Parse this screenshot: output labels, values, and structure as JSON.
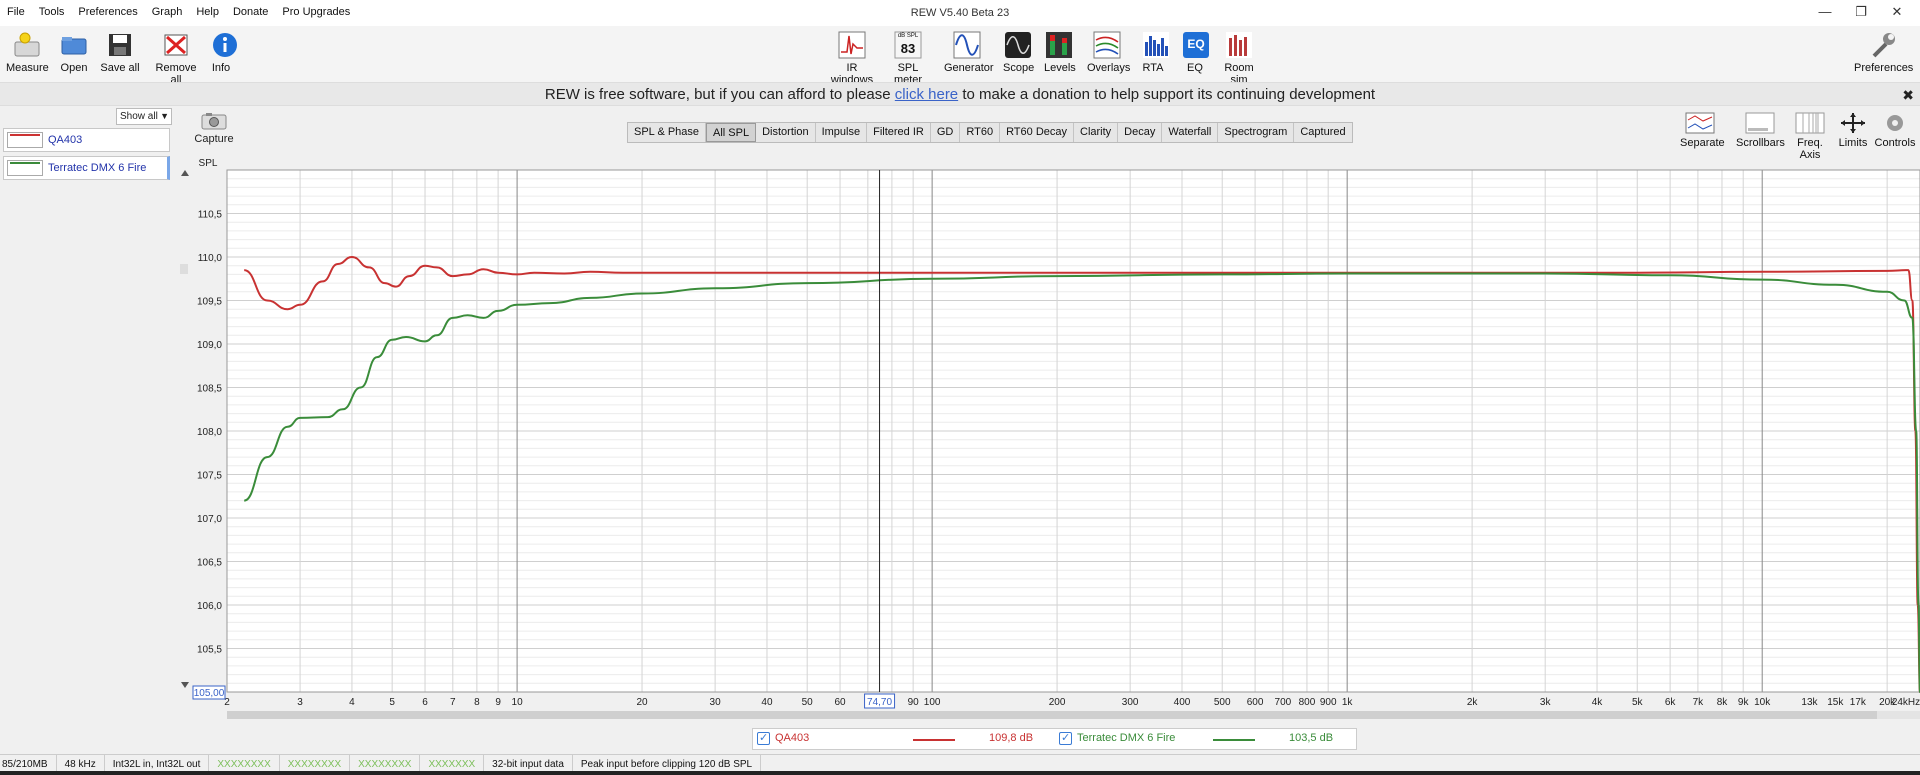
{
  "window": {
    "title": "REW V5.40 Beta 23",
    "menu": [
      "File",
      "Tools",
      "Preferences",
      "Graph",
      "Help",
      "Donate",
      "Pro Upgrades"
    ]
  },
  "toolbar": {
    "left": [
      {
        "label": "Measure",
        "icon": "measure-icon"
      },
      {
        "label": "Open",
        "icon": "open-folder-icon"
      },
      {
        "label": "Save all",
        "icon": "save-disk-icon"
      },
      {
        "label": "Remove all",
        "icon": "remove-all-icon"
      },
      {
        "label": "Info",
        "icon": "info-icon"
      }
    ],
    "center": [
      {
        "label": "IR windows",
        "icon": "ir-windows-icon"
      },
      {
        "label": "SPL meter",
        "icon": "spl-meter-icon"
      },
      {
        "label": "Generator",
        "icon": "generator-icon"
      },
      {
        "label": "Scope",
        "icon": "scope-icon"
      },
      {
        "label": "Levels",
        "icon": "levels-icon"
      },
      {
        "label": "Overlays",
        "icon": "overlays-icon"
      },
      {
        "label": "RTA",
        "icon": "rta-icon"
      },
      {
        "label": "EQ",
        "icon": "eq-icon"
      },
      {
        "label": "Room sim",
        "icon": "room-sim-icon"
      }
    ],
    "spl_meter_caption": "dB SPL",
    "spl_meter_value": "83",
    "eq_text": "EQ",
    "right": {
      "label": "Preferences",
      "icon": "wrench-icon"
    }
  },
  "donate": {
    "before": "REW is free software, but if you can afford to please ",
    "link": "click here",
    "after": " to make a donation to help support its continuing development",
    "close": "✖"
  },
  "sidebar": {
    "filter": "Show all",
    "measurements": [
      {
        "name": "QA403",
        "color": "#cc3333"
      },
      {
        "name": "Terratec DMX 6 Fire",
        "color": "#3a8a3a"
      }
    ]
  },
  "capture_label": "Capture",
  "tabs": [
    "SPL & Phase",
    "All SPL",
    "Distortion",
    "Impulse",
    "Filtered IR",
    "GD",
    "RT60",
    "RT60 Decay",
    "Clarity",
    "Decay",
    "Waterfall",
    "Spectrogram",
    "Captured"
  ],
  "active_tab": "All SPL",
  "graph_controls": [
    {
      "label": "Separate",
      "icon": "separate-icon"
    },
    {
      "label": "Scrollbars",
      "icon": "scrollbars-icon"
    },
    {
      "label": "Freq. Axis",
      "icon": "freq-axis-icon"
    },
    {
      "label": "Limits",
      "icon": "limits-icon"
    },
    {
      "label": "Controls",
      "icon": "controls-gear-icon"
    }
  ],
  "chart_data": {
    "type": "line",
    "ylabel": "SPL",
    "ylim": [
      105.0,
      111.0
    ],
    "yticks": [
      "110,5",
      "110,0",
      "109,5",
      "109,0",
      "108,5",
      "108,0",
      "107,5",
      "107,0",
      "106,5",
      "106,0",
      "105,5"
    ],
    "ymin_box": "105,00",
    "x_scale": "log",
    "xlim": [
      2,
      24000
    ],
    "xticks": [
      {
        "v": 2,
        "t": "2"
      },
      {
        "v": 3,
        "t": "3"
      },
      {
        "v": 4,
        "t": "4"
      },
      {
        "v": 5,
        "t": "5"
      },
      {
        "v": 6,
        "t": "6"
      },
      {
        "v": 7,
        "t": "7"
      },
      {
        "v": 8,
        "t": "8"
      },
      {
        "v": 9,
        "t": "9"
      },
      {
        "v": 10,
        "t": "10"
      },
      {
        "v": 20,
        "t": "20"
      },
      {
        "v": 30,
        "t": "30"
      },
      {
        "v": 40,
        "t": "40"
      },
      {
        "v": 50,
        "t": "50"
      },
      {
        "v": 60,
        "t": "60"
      },
      {
        "v": 90,
        "t": "90"
      },
      {
        "v": 100,
        "t": "100"
      },
      {
        "v": 200,
        "t": "200"
      },
      {
        "v": 300,
        "t": "300"
      },
      {
        "v": 400,
        "t": "400"
      },
      {
        "v": 500,
        "t": "500"
      },
      {
        "v": 600,
        "t": "600"
      },
      {
        "v": 700,
        "t": "700"
      },
      {
        "v": 800,
        "t": "800"
      },
      {
        "v": 900,
        "t": "900"
      },
      {
        "v": 1000,
        "t": "1k"
      },
      {
        "v": 2000,
        "t": "2k"
      },
      {
        "v": 3000,
        "t": "3k"
      },
      {
        "v": 4000,
        "t": "4k"
      },
      {
        "v": 5000,
        "t": "5k"
      },
      {
        "v": 6000,
        "t": "6k"
      },
      {
        "v": 7000,
        "t": "7k"
      },
      {
        "v": 8000,
        "t": "8k"
      },
      {
        "v": 9000,
        "t": "9k"
      },
      {
        "v": 10000,
        "t": "10k"
      },
      {
        "v": 13000,
        "t": "13k"
      },
      {
        "v": 15000,
        "t": "15k"
      },
      {
        "v": 17000,
        "t": "17k"
      },
      {
        "v": 20000,
        "t": "20k"
      },
      {
        "v": 24000,
        "t": "24kHz"
      }
    ],
    "cursor": {
      "x": 74.7,
      "label": "74,70"
    },
    "grid": true,
    "series": [
      {
        "name": "QA403",
        "color": "#c83232",
        "points": [
          [
            2.2,
            109.85
          ],
          [
            2.5,
            109.5
          ],
          [
            2.8,
            109.4
          ],
          [
            3.0,
            109.45
          ],
          [
            3.4,
            109.72
          ],
          [
            3.7,
            109.92
          ],
          [
            4.0,
            110.0
          ],
          [
            4.4,
            109.88
          ],
          [
            4.8,
            109.7
          ],
          [
            5.1,
            109.66
          ],
          [
            5.5,
            109.78
          ],
          [
            6.0,
            109.9
          ],
          [
            6.4,
            109.88
          ],
          [
            7.0,
            109.78
          ],
          [
            7.6,
            109.8
          ],
          [
            8.3,
            109.86
          ],
          [
            9.0,
            109.82
          ],
          [
            10,
            109.8
          ],
          [
            11,
            109.82
          ],
          [
            13,
            109.81
          ],
          [
            15,
            109.83
          ],
          [
            18,
            109.82
          ],
          [
            20,
            109.82
          ],
          [
            50,
            109.82
          ],
          [
            100,
            109.82
          ],
          [
            1000,
            109.82
          ],
          [
            5000,
            109.82
          ],
          [
            10000,
            109.83
          ],
          [
            20000,
            109.84
          ],
          [
            22500,
            109.85
          ],
          [
            23000,
            109.5
          ],
          [
            23400,
            108.0
          ],
          [
            23700,
            106.0
          ],
          [
            24000,
            105.0
          ]
        ]
      },
      {
        "name": "Terratec DMX 6 Fire",
        "color": "#3a8c3a",
        "points": [
          [
            2.2,
            107.2
          ],
          [
            2.5,
            107.7
          ],
          [
            2.8,
            108.05
          ],
          [
            3.0,
            108.15
          ],
          [
            3.5,
            108.16
          ],
          [
            3.8,
            108.25
          ],
          [
            4.2,
            108.5
          ],
          [
            4.6,
            108.85
          ],
          [
            5.0,
            109.05
          ],
          [
            5.4,
            109.08
          ],
          [
            6.0,
            109.03
          ],
          [
            6.4,
            109.1
          ],
          [
            7.0,
            109.3
          ],
          [
            7.6,
            109.33
          ],
          [
            8.3,
            109.3
          ],
          [
            9.0,
            109.38
          ],
          [
            10,
            109.45
          ],
          [
            12,
            109.47
          ],
          [
            15,
            109.53
          ],
          [
            20,
            109.58
          ],
          [
            30,
            109.64
          ],
          [
            50,
            109.7
          ],
          [
            100,
            109.75
          ],
          [
            200,
            109.78
          ],
          [
            500,
            109.8
          ],
          [
            1000,
            109.81
          ],
          [
            3000,
            109.81
          ],
          [
            6000,
            109.79
          ],
          [
            10000,
            109.74
          ],
          [
            15000,
            109.68
          ],
          [
            20000,
            109.6
          ],
          [
            22000,
            109.5
          ],
          [
            23000,
            109.3
          ],
          [
            23500,
            108.0
          ],
          [
            23800,
            106.0
          ],
          [
            24000,
            105.0
          ]
        ]
      }
    ]
  },
  "legend": {
    "items": [
      {
        "name": "QA403",
        "value": "109,8 dB",
        "color": "#c83232"
      },
      {
        "name": "Terratec DMX 6 Fire",
        "value": "103,5 dB",
        "color": "#3a8c3a"
      }
    ]
  },
  "statusbar": [
    "85/210MB",
    "48 kHz",
    "Int32L in, Int32L out",
    "XXXXXXXX",
    "XXXXXXXX",
    "XXXXXXXX",
    "XXXXXXX",
    "32-bit input data",
    "Peak input before clipping 120 dB SPL"
  ]
}
